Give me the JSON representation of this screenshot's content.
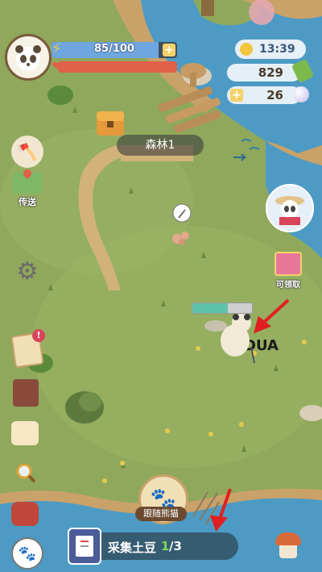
{
  "hud": {
    "hp": "85/100",
    "hp_fraction": 0.85,
    "clock": "13:39",
    "coins": "829",
    "pearls": "26",
    "plus": "+"
  },
  "location": {
    "name": "森林1"
  },
  "left_menu": {
    "teleport_label": "传送"
  },
  "right_menu": {
    "gift_label": "可领取"
  },
  "player": {
    "action_progress": 0.6
  },
  "bottom": {
    "follow_label": "跟随熊猫",
    "quest_title": "采集土豆",
    "quest_progress_current": "1",
    "quest_progress_total": "/3"
  },
  "annotations": {
    "dua_text": "DUA"
  },
  "colors": {
    "grass": "#8fa85c",
    "water": "#4d9bc4",
    "path": "#d1b27a",
    "hp_bar": "#6fa6e0",
    "red_bar": "#e0604a",
    "arrow": "#e02020"
  }
}
